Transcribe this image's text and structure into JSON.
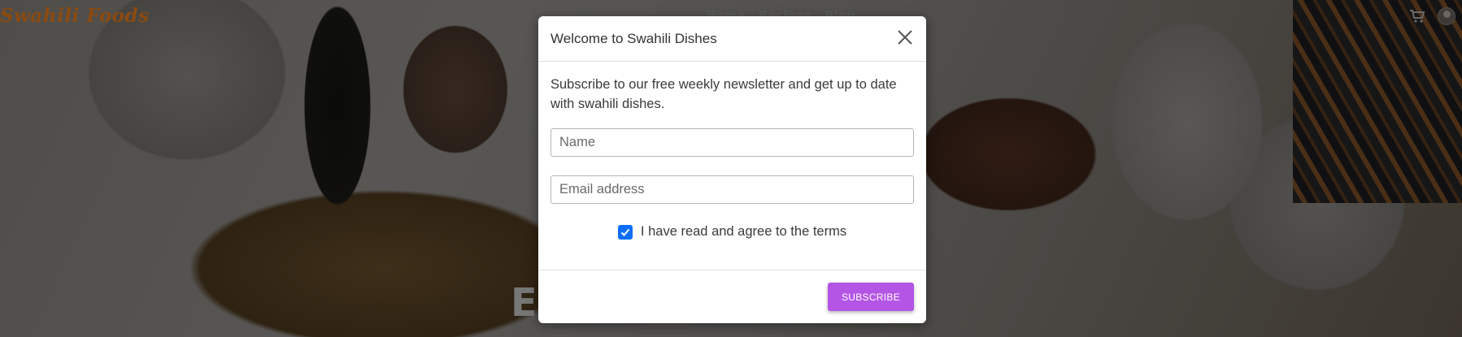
{
  "header": {
    "brand": "Swahili Foods",
    "nav": [
      "Home",
      "Recipes",
      "Blog"
    ],
    "cart_icon": "cart-icon",
    "avatar_icon": "user-avatar"
  },
  "hero": {
    "title": "Ex                        e"
  },
  "modal": {
    "title": "Welcome to Swahili Dishes",
    "close_icon": "close-icon",
    "description": "Subscribe to our free weekly newsletter and get up to date with swahili dishes.",
    "name_placeholder": "Name",
    "email_placeholder": "Email address",
    "terms_label": "I have read and agree to the terms",
    "terms_checked": true,
    "subscribe_label": "SUBSCRIBE"
  },
  "colors": {
    "accent": "#b455e6",
    "checkbox": "#0d6efd",
    "brand": "#8a4a10"
  }
}
